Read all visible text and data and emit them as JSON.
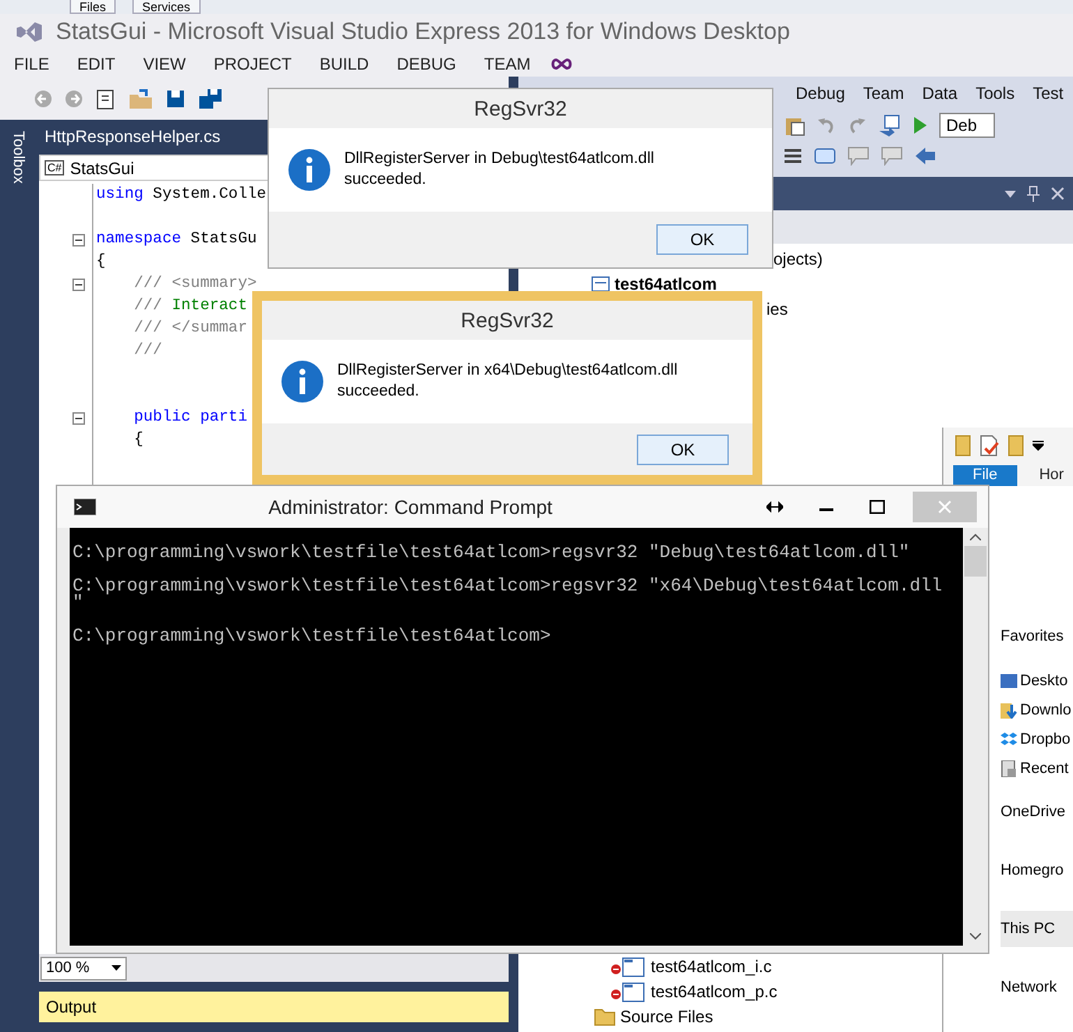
{
  "top_strip": {
    "tabs": [
      "Files",
      "Services"
    ]
  },
  "vs2013": {
    "title": "StatsGui - Microsoft Visual Studio Express 2013 for Windows Desktop",
    "menu": [
      "FILE",
      "EDIT",
      "VIEW",
      "PROJECT",
      "BUILD",
      "DEBUG",
      "TEAM"
    ],
    "toolbox": "Toolbox",
    "document_tab": "HttpResponseHelper.cs",
    "language_badge": "C#",
    "navigation_dropdown": "StatsGui",
    "code_lines": [
      {
        "kind": "code",
        "fold": false,
        "segments": [
          {
            "kind": "keyword",
            "text": "using"
          },
          {
            "kind": "plain",
            "text": " System.Colle"
          }
        ]
      },
      {
        "kind": "blank"
      },
      {
        "kind": "code",
        "fold": true,
        "segments": [
          {
            "kind": "keyword",
            "text": "namespace"
          },
          {
            "kind": "plain",
            "text": " StatsGu"
          }
        ]
      },
      {
        "kind": "code",
        "fold": false,
        "segments": [
          {
            "kind": "plain",
            "text": "{"
          }
        ]
      },
      {
        "kind": "code",
        "fold": true,
        "segments": [
          {
            "kind": "doc",
            "text": "    /// <summary>"
          }
        ]
      },
      {
        "kind": "code",
        "fold": false,
        "segments": [
          {
            "kind": "doc",
            "text": "    /// "
          },
          {
            "kind": "comment",
            "text": "Interact"
          }
        ]
      },
      {
        "kind": "code",
        "fold": false,
        "segments": [
          {
            "kind": "doc",
            "text": "    /// </summar"
          }
        ]
      },
      {
        "kind": "code",
        "fold": false,
        "segments": [
          {
            "kind": "doc",
            "text": "    ///"
          }
        ]
      },
      {
        "kind": "blank"
      },
      {
        "kind": "blank"
      },
      {
        "kind": "code",
        "fold": true,
        "segments": [
          {
            "kind": "keyword",
            "text": "    public parti"
          }
        ]
      },
      {
        "kind": "code",
        "fold": false,
        "segments": [
          {
            "kind": "plain",
            "text": "    {"
          }
        ]
      }
    ],
    "zoom": "100 %",
    "output_panel": "Output"
  },
  "vs_old": {
    "menu": [
      "Debug",
      "Team",
      "Data",
      "Tools",
      "Test"
    ],
    "configuration": "Deb",
    "tree_top": [
      {
        "label": "ojects)",
        "kind": "text"
      },
      {
        "label": "test64atlcom",
        "kind": "project"
      },
      {
        "label": "ies",
        "kind": "text"
      }
    ],
    "tree_bottom": [
      {
        "label": "test64atlcom_i.c",
        "kind": "cpp_file"
      },
      {
        "label": "test64atlcom_p.c",
        "kind": "cpp_file"
      },
      {
        "label": "Source Files",
        "kind": "folder"
      }
    ]
  },
  "explorer": {
    "ribbon_tabs": [
      {
        "label": "File",
        "selected": true
      },
      {
        "label": "Hor",
        "selected": false
      }
    ],
    "nav": [
      {
        "label": "Favorites",
        "kind": "group",
        "selected": false
      },
      {
        "label": "Deskto",
        "kind": "desktop",
        "selected": false
      },
      {
        "label": "Downlo",
        "kind": "downloads",
        "selected": false
      },
      {
        "label": "Dropbo",
        "kind": "dropbox",
        "selected": false
      },
      {
        "label": "Recent",
        "kind": "recent",
        "selected": false
      },
      {
        "label": "OneDrive",
        "kind": "group",
        "selected": false
      },
      {
        "label": "Homegro",
        "kind": "group",
        "selected": false
      },
      {
        "label": "This PC",
        "kind": "group",
        "selected": true
      },
      {
        "label": "Network",
        "kind": "group",
        "selected": false
      }
    ]
  },
  "dialogs": [
    {
      "title": "RegSvr32",
      "message": "DllRegisterServer in Debug\\test64atlcom.dll succeeded.",
      "button": "OK",
      "active": false
    },
    {
      "title": "RegSvr32",
      "message": "DllRegisterServer in x64\\Debug\\test64atlcom.dll succeeded.",
      "button": "OK",
      "active": true
    }
  ],
  "command_prompt": {
    "title": "Administrator: Command Prompt",
    "lines": [
      "C:\\programming\\vswork\\testfile\\test64atlcom>regsvr32 \"Debug\\test64atlcom.dll\"",
      "C:\\programming\\vswork\\testfile\\test64atlcom>regsvr32 \"x64\\Debug\\test64atlcom.dll\"",
      "C:\\programming\\vswork\\testfile\\test64atlcom>"
    ]
  }
}
